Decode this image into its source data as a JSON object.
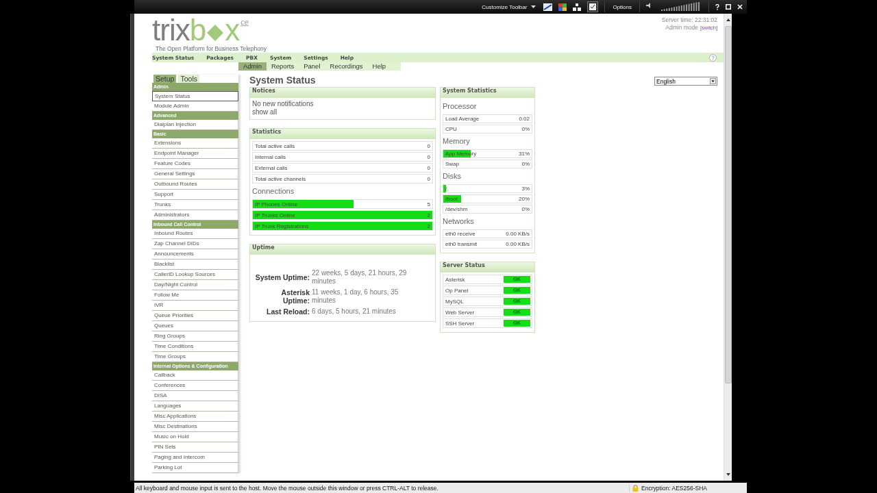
{
  "vm_toolbar": {
    "customize": "Customize Toolbar",
    "options": "Options"
  },
  "page_header": {
    "logo": {
      "wordmark_start": "trix",
      "accent_before": "b",
      "accent_after": "x",
      "edition": "ce",
      "tagline": "The Open Platform for Business Telephony"
    },
    "server_time": "Server time: 22:31:02",
    "mode_label": "Admin mode",
    "mode_link": "[switch]"
  },
  "top_nav": [
    {
      "label": "System Status"
    },
    {
      "label": "Packages"
    },
    {
      "label": "PBX"
    },
    {
      "label": "System"
    },
    {
      "label": "Settings"
    },
    {
      "label": "Help"
    }
  ],
  "sub_nav": [
    {
      "label": "Admin",
      "selected": true
    },
    {
      "label": "Reports",
      "selected": false
    },
    {
      "label": "Panel",
      "selected": false
    },
    {
      "label": "Recordings",
      "selected": false
    },
    {
      "label": "Help",
      "selected": false
    }
  ],
  "sidebar": {
    "tabs": [
      {
        "label": "Setup",
        "selected": true
      },
      {
        "label": "Tools",
        "selected": false
      }
    ],
    "sections": [
      {
        "title": "Admin",
        "items": [
          {
            "label": "System Status",
            "selected": true
          },
          {
            "label": "Module Admin",
            "selected": false
          }
        ]
      },
      {
        "title": "Advanced",
        "items": [
          {
            "label": "Dialplan Injection",
            "selected": false
          }
        ]
      },
      {
        "title": "Basic",
        "items": [
          {
            "label": "Extensions",
            "selected": false
          },
          {
            "label": "Endpoint Manager",
            "selected": false
          },
          {
            "label": "Feature Codes",
            "selected": false
          },
          {
            "label": "General Settings",
            "selected": false
          },
          {
            "label": "Outbound Routes",
            "selected": false
          },
          {
            "label": "Support",
            "selected": false
          },
          {
            "label": "Trunks",
            "selected": false
          },
          {
            "label": "Administrators",
            "selected": false
          }
        ]
      },
      {
        "title": "Inbound Call Control",
        "items": [
          {
            "label": "Inbound Routes",
            "selected": false
          },
          {
            "label": "Zap Channel DIDs",
            "selected": false
          },
          {
            "label": "Announcements",
            "selected": false
          },
          {
            "label": "Blacklist",
            "selected": false
          },
          {
            "label": "CallerID Lookup Sources",
            "selected": false
          },
          {
            "label": "Day/Night Control",
            "selected": false
          },
          {
            "label": "Follow Me",
            "selected": false
          },
          {
            "label": "IVR",
            "selected": false
          },
          {
            "label": "Queue Priorities",
            "selected": false
          },
          {
            "label": "Queues",
            "selected": false
          },
          {
            "label": "Ring Groups",
            "selected": false
          },
          {
            "label": "Time Conditions",
            "selected": false
          },
          {
            "label": "Time Groups",
            "selected": false
          }
        ]
      },
      {
        "title": "Internal Options & Configuration",
        "items": [
          {
            "label": "Callback",
            "selected": false
          },
          {
            "label": "Conferences",
            "selected": false
          },
          {
            "label": "DISA",
            "selected": false
          },
          {
            "label": "Languages",
            "selected": false
          },
          {
            "label": "Misc Applications",
            "selected": false
          },
          {
            "label": "Misc Destinations",
            "selected": false
          },
          {
            "label": "Music on Hold",
            "selected": false
          },
          {
            "label": "PIN Sets",
            "selected": false
          },
          {
            "label": "Paging and Intercom",
            "selected": false
          },
          {
            "label": "Parking Lot",
            "selected": false
          }
        ]
      }
    ]
  },
  "page_title": "System Status",
  "notices": {
    "title": "Notices",
    "message": "No new notifications",
    "link": "show all"
  },
  "statistics": {
    "title": "Statistics",
    "rows": [
      {
        "label": "Total active calls",
        "value": "0"
      },
      {
        "label": "Internal calls",
        "value": "0"
      },
      {
        "label": "External calls",
        "value": "0"
      },
      {
        "label": "Total active channels",
        "value": "0"
      }
    ],
    "connections_heading": "Connections",
    "connections": [
      {
        "label": "IP Phones Online",
        "value": "5",
        "level": 0.56
      },
      {
        "label": "IP Trunks Online",
        "value": "2",
        "level": 1
      },
      {
        "label": "IP Trunk Registrations",
        "value": "2",
        "level": 1
      }
    ]
  },
  "uptime": {
    "title": "Uptime",
    "rows": [
      {
        "label": "System Uptime:",
        "value": "22 weeks, 5 days, 21 hours, 29 minutes"
      },
      {
        "label": "Asterisk Uptime:",
        "value": "11 weeks, 1 day, 6 hours, 35 minutes"
      },
      {
        "label": "Last Reload:",
        "value": "6 days, 5 hours, 21 minutes"
      }
    ]
  },
  "system_statistics": {
    "title": "System Statistics",
    "groups": [
      {
        "heading": "Processor",
        "rows": [
          {
            "label": "Load Average",
            "value": "0.02"
          },
          {
            "label": "CPU",
            "value": "0%",
            "level": 0
          }
        ]
      },
      {
        "heading": "Memory",
        "rows": [
          {
            "label": "App Memory",
            "value": "31%",
            "level": 0.31
          },
          {
            "label": "Swap",
            "value": "0%",
            "level": 0
          }
        ]
      },
      {
        "heading": "Disks",
        "rows": [
          {
            "label": "/",
            "value": "3%",
            "level": 0.03
          },
          {
            "label": "/boot",
            "value": "20%",
            "level": 0.2
          },
          {
            "label": "/dev/shm",
            "value": "0%",
            "level": 0
          }
        ]
      },
      {
        "heading": "Networks",
        "rows": [
          {
            "label": "eth0 receive",
            "value": "0.00 KB/s"
          },
          {
            "label": "eth0 transmit",
            "value": "0.00 KB/s"
          }
        ]
      }
    ]
  },
  "server_status": {
    "title": "Server Status",
    "rows": [
      {
        "label": "Asterisk",
        "status": "OK",
        "up": true
      },
      {
        "label": "Op Panel",
        "status": "OK",
        "up": true
      },
      {
        "label": "MySQL",
        "status": "OK",
        "up": true
      },
      {
        "label": "Web Server",
        "status": "OK",
        "up": true
      },
      {
        "label": "SSH Server",
        "status": "OK",
        "up": true
      }
    ]
  },
  "language_select": {
    "value": "English"
  },
  "status_bar": {
    "message": "All keyboard and mouse input is sent to the host. Move the mouse outside this window or press CTRL-ALT to release.",
    "encryption": "Encryption: AES256-SHA"
  }
}
